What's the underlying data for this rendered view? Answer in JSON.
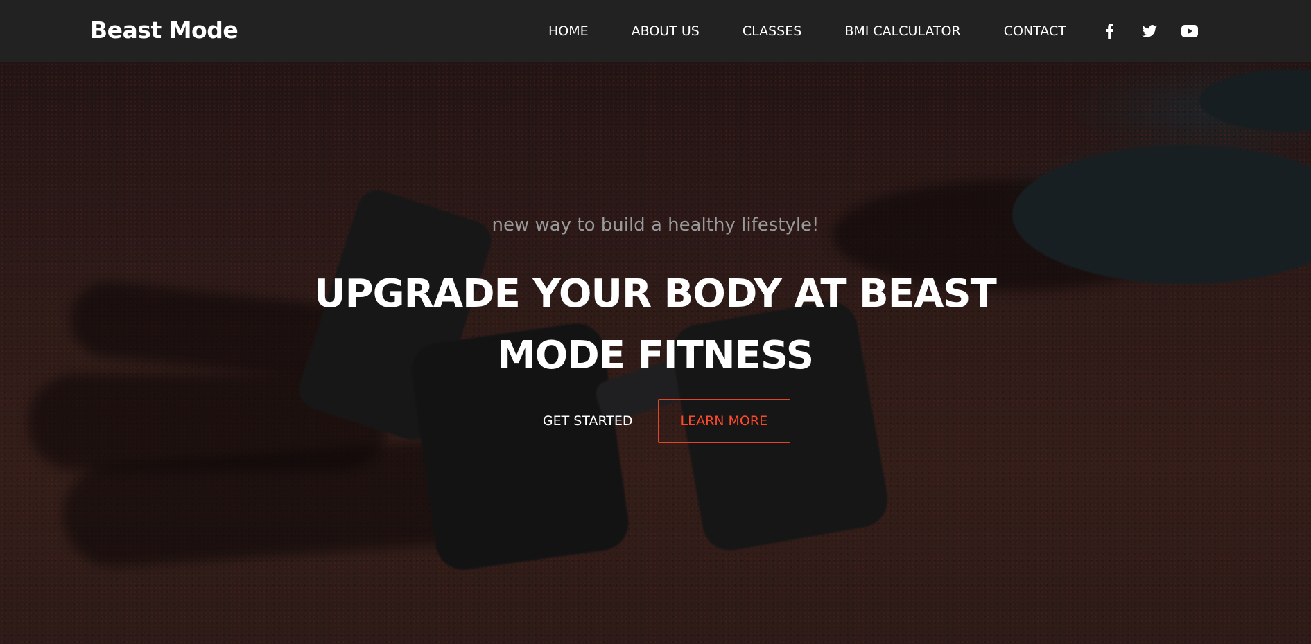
{
  "brand": {
    "name": "Beast Mode"
  },
  "nav": {
    "items": [
      {
        "label": "HOME"
      },
      {
        "label": "ABOUT US"
      },
      {
        "label": "CLASSES"
      },
      {
        "label": "BMI CALCULATOR"
      },
      {
        "label": "CONTACT"
      }
    ]
  },
  "social": {
    "icons": [
      "facebook-icon",
      "twitter-icon",
      "youtube-icon"
    ]
  },
  "hero": {
    "tagline": "new way to build a healthy lifestyle!",
    "headline": "UPGRADE YOUR BODY AT BEAST MODE FITNESS",
    "primary_button": "GET STARTED",
    "secondary_button": "LEARN MORE"
  },
  "colors": {
    "navbar": "#222222",
    "accent": "#ff4a2a",
    "text": "#ffffff",
    "tagline": "#9a9a9a"
  }
}
